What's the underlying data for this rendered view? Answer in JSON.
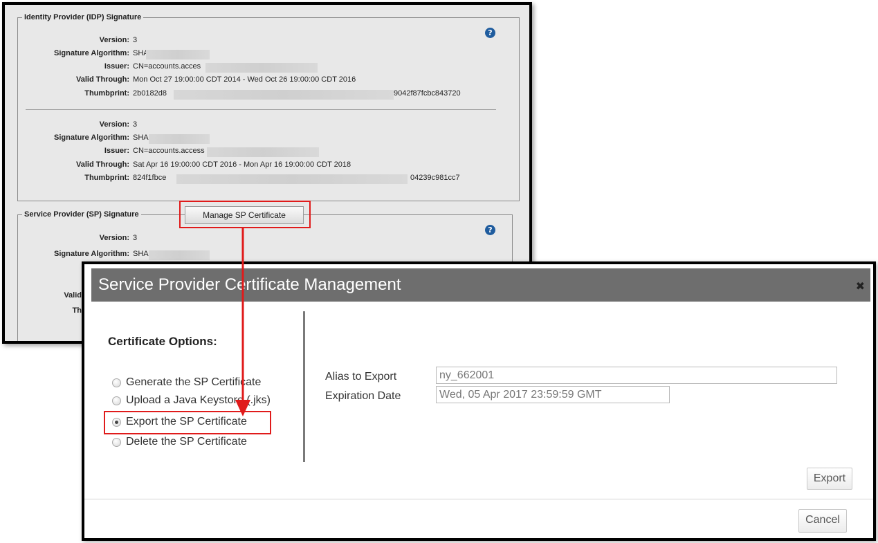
{
  "idp": {
    "legend": "Identity Provider (IDP) Signature",
    "certs": [
      {
        "version_label": "Version:",
        "version": "3",
        "algorithm_label": "Signature Algorithm:",
        "algorithm": "SHA",
        "issuer_label": "Issuer:",
        "issuer": "CN=accounts.acces",
        "valid_label": "Valid Through:",
        "valid": "Mon Oct 27 19:00:00 CDT 2014 - Wed Oct 26 19:00:00 CDT 2016",
        "thumb_label": "Thumbprint:",
        "thumb_start": "2b0182d8",
        "thumb_end": "9042f87fcbc843720"
      },
      {
        "version_label": "Version:",
        "version": "3",
        "algorithm_label": "Signature Algorithm:",
        "algorithm": "SHA",
        "issuer_label": "Issuer:",
        "issuer": "CN=accounts.access",
        "valid_label": "Valid Through:",
        "valid": "Sat Apr 16 19:00:00 CDT 2016 - Mon Apr 16 19:00:00 CDT 2018",
        "thumb_label": "Thumbprint:",
        "thumb_start": "824f1fbce",
        "thumb_end": "04239c981cc7"
      }
    ]
  },
  "sp": {
    "legend": "Service Provider (SP) Signature",
    "manage_button": "Manage SP Certificate",
    "version_label": "Version:",
    "version": "3",
    "algorithm_label": "Signature Algorithm:",
    "algorithm": "SHA",
    "valid_label_partial": "Valid",
    "thumb_label_partial": "Th"
  },
  "help_icon": "?",
  "modal": {
    "title": "Service Provider Certificate Management",
    "close": "✖",
    "options_title": "Certificate Options:",
    "options": [
      {
        "label": "Generate the SP Certificate",
        "selected": false
      },
      {
        "label": "Upload a Java Keystore (.jks)",
        "selected": false
      },
      {
        "label": "Export the SP Certificate",
        "selected": true
      },
      {
        "label": "Delete the SP Certificate",
        "selected": false
      }
    ],
    "alias_label": "Alias to Export",
    "alias_value": "ny_662001",
    "expiration_label": "Expiration Date",
    "expiration_value": "Wed, 05 Apr 2017 23:59:59 GMT",
    "export_button": "Export",
    "cancel_button": "Cancel"
  },
  "colors": {
    "highlight": "#e01b1b",
    "header_bg": "#6e6e6e",
    "help_icon": "#1f5c9e",
    "panel_bg": "#e8e8e8"
  }
}
